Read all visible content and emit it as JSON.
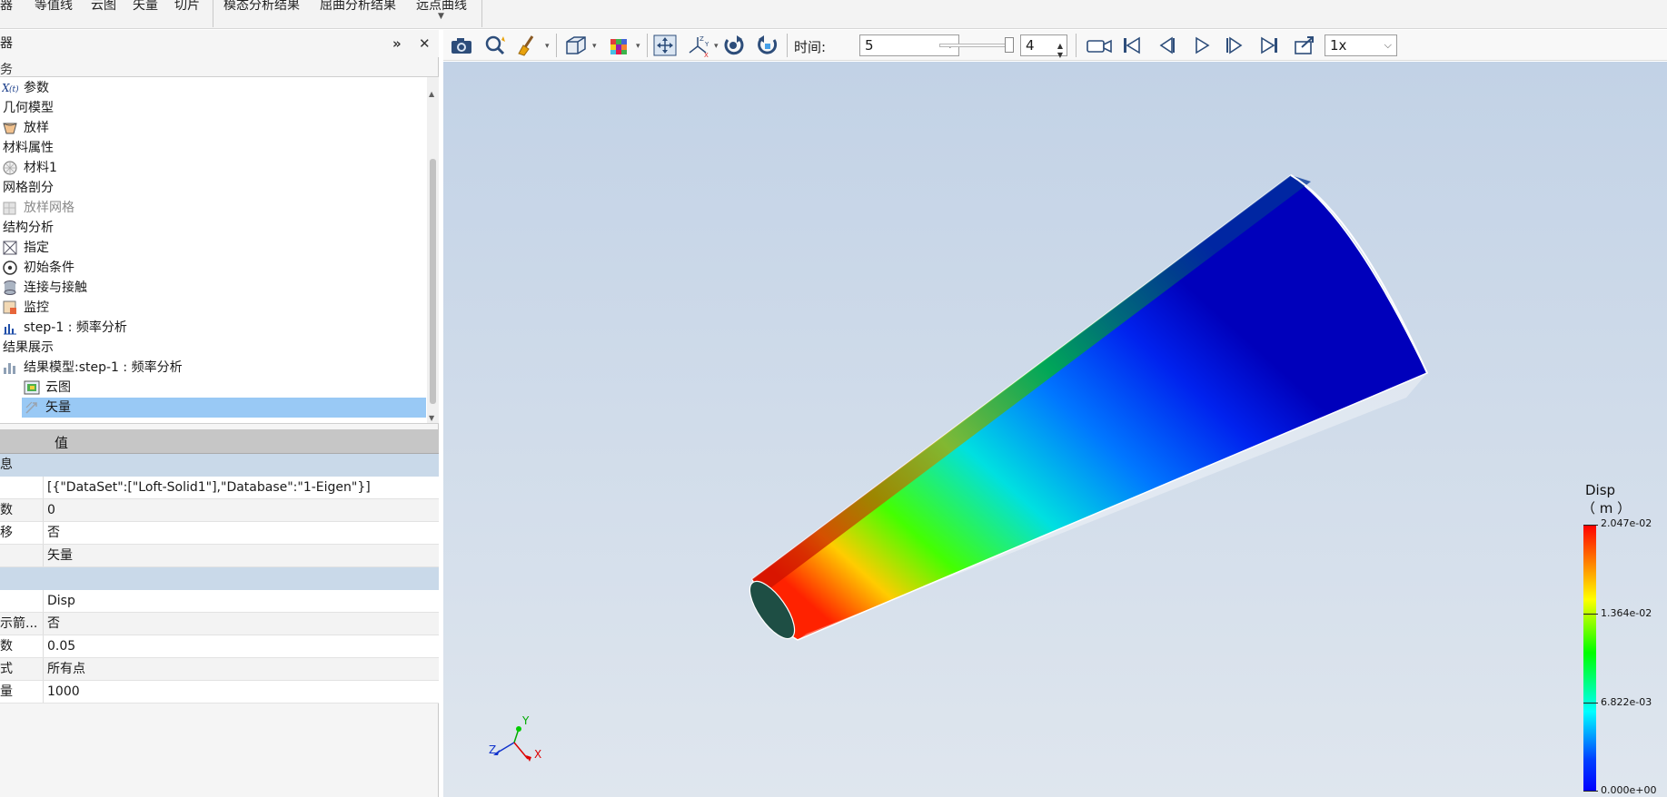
{
  "ribbon": {
    "items": [
      "器",
      "等值线",
      "云图",
      "矢量",
      "切片",
      "模态分析结果",
      "屈曲分析结果",
      "远点曲线"
    ]
  },
  "panel": {
    "title_fragment": "器",
    "subtitle_fragment": "务"
  },
  "tree": {
    "items": [
      {
        "label": "参数",
        "icon": "function-xt-icon"
      },
      {
        "label": "几何模型"
      },
      {
        "label": "放样",
        "icon": "loft-icon"
      },
      {
        "label": "材料属性"
      },
      {
        "label": "材料1",
        "icon": "material-sphere-icon"
      },
      {
        "label": "网格剖分"
      },
      {
        "label": "放样网格",
        "icon": "mesh-icon",
        "disabled": true
      },
      {
        "label": "结构分析"
      },
      {
        "label": "指定",
        "icon": "assign-icon"
      },
      {
        "label": "初始条件",
        "icon": "initial-condition-icon"
      },
      {
        "label": "连接与接触",
        "icon": "contact-icon"
      },
      {
        "label": "监控",
        "icon": "monitor-icon"
      },
      {
        "label": "step-1 : 频率分析",
        "icon": "step-chart-icon"
      },
      {
        "label": "结果展示"
      },
      {
        "label": "结果模型:step-1 : 频率分析",
        "icon": "result-model-icon"
      },
      {
        "label": "云图",
        "icon": "contour-icon"
      },
      {
        "label": "矢量",
        "icon": "vector-icon",
        "selected": true
      }
    ]
  },
  "props": {
    "value_header": "值",
    "group1": "息",
    "rows1": [
      {
        "key": "",
        "value": "[{\"DataSet\":[\"Loft-Solid1\"],\"Database\":\"1-Eigen\"}]"
      },
      {
        "key": "数",
        "value": "0"
      },
      {
        "key": "移",
        "value": "否"
      },
      {
        "key": "",
        "value": "矢量"
      }
    ],
    "rows2": [
      {
        "key": "",
        "value": "Disp"
      },
      {
        "key": "示箭...",
        "value": "否"
      },
      {
        "key": "数",
        "value": "0.05"
      },
      {
        "key": "式",
        "value": "所有点"
      },
      {
        "key": "量",
        "value": "1000"
      }
    ]
  },
  "toolbar": {
    "time_label": "时间:",
    "time_value": "5",
    "frame_value": "4",
    "speed_value": "1x"
  },
  "legend": {
    "title": "Disp",
    "unit": "（ m ）",
    "values": [
      "2.047e-02",
      "1.364e-02",
      "6.822e-03",
      "0.000e+00"
    ]
  },
  "axes": {
    "x": "X",
    "y": "Y",
    "z": "Z"
  },
  "colors": {
    "selection": "#99c9f5",
    "group_row": "#c9d9e9",
    "viewport_top": "#c2d2e6",
    "viewport_bottom": "#dfe6ee"
  }
}
